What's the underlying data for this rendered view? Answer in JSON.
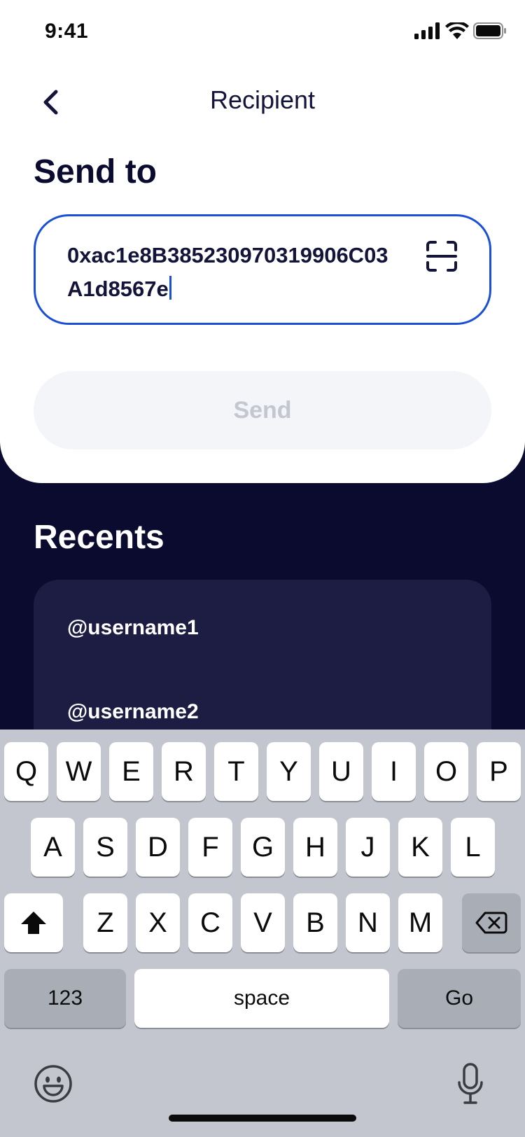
{
  "status_bar": {
    "time": "9:41",
    "icons": [
      "signal-icon",
      "wifi-icon",
      "battery-icon"
    ]
  },
  "nav": {
    "title": "Recipient",
    "back_icon": "chevron-left-icon"
  },
  "form": {
    "heading": "Send to",
    "address_value": "0xac1e8B385230970319906C03A1d8567e",
    "scan_icon": "qr-scan-icon",
    "send_label": "Send"
  },
  "recents": {
    "heading": "Recents",
    "items": [
      "@username1",
      "@username2"
    ]
  },
  "keyboard": {
    "row1": [
      "Q",
      "W",
      "E",
      "R",
      "T",
      "Y",
      "U",
      "I",
      "O",
      "P"
    ],
    "row2": [
      "A",
      "S",
      "D",
      "F",
      "G",
      "H",
      "J",
      "K",
      "L"
    ],
    "row3": [
      "Z",
      "X",
      "C",
      "V",
      "B",
      "N",
      "M"
    ],
    "numbers_label": "123",
    "space_label": "space",
    "go_label": "Go",
    "icons": [
      "shift-icon",
      "backspace-icon",
      "emoji-icon",
      "microphone-icon"
    ]
  },
  "colors": {
    "accent": "#1a4fd6",
    "navy": "#0b0b30",
    "card": "#1d1d44",
    "disabled_button": "#f4f5f8",
    "keyboard_bg": "#c3c6cf"
  }
}
